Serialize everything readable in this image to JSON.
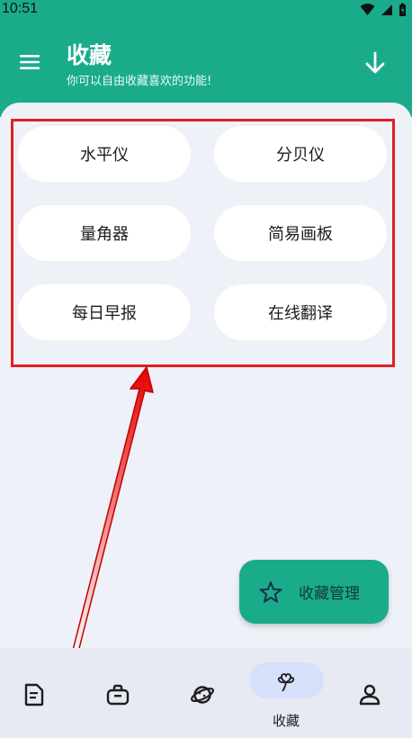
{
  "status_bar": {
    "time": "10:51"
  },
  "header": {
    "title": "收藏",
    "subtitle": "你可以自由收藏喜欢的功能!"
  },
  "tools": [
    {
      "label": "水平仪"
    },
    {
      "label": "分贝仪"
    },
    {
      "label": "量角器"
    },
    {
      "label": "简易画板"
    },
    {
      "label": "每日早报"
    },
    {
      "label": "在线翻译"
    }
  ],
  "fab": {
    "label": "收藏管理",
    "icon": "star-icon"
  },
  "bottom_nav": {
    "items": [
      {
        "icon": "document-icon"
      },
      {
        "icon": "toolbox-icon"
      },
      {
        "icon": "planet-icon"
      },
      {
        "icon": "clover-icon",
        "label": "收藏",
        "active": true
      },
      {
        "icon": "user-icon"
      }
    ]
  },
  "colors": {
    "accent": "#1aab8b",
    "highlight": "#e02020",
    "background": "#eef1f7"
  }
}
